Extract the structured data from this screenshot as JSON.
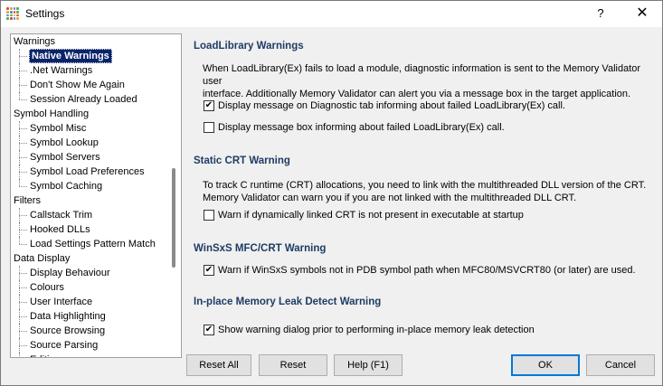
{
  "window": {
    "title": "Settings",
    "help_label": "?",
    "close_label": "✕"
  },
  "tree": {
    "items": [
      {
        "label": "Warnings",
        "level": 0
      },
      {
        "label": "Native Warnings",
        "level": 1,
        "selected": true
      },
      {
        "label": ".Net Warnings",
        "level": 1
      },
      {
        "label": "Don't Show Me Again",
        "level": 1
      },
      {
        "label": "Session Already Loaded",
        "level": 1,
        "last": true
      },
      {
        "label": "Symbol Handling",
        "level": 0
      },
      {
        "label": "Symbol Misc",
        "level": 1
      },
      {
        "label": "Symbol Lookup",
        "level": 1
      },
      {
        "label": "Symbol Servers",
        "level": 1
      },
      {
        "label": "Symbol Load Preferences",
        "level": 1
      },
      {
        "label": "Symbol Caching",
        "level": 1,
        "last": true
      },
      {
        "label": "Filters",
        "level": 0
      },
      {
        "label": "Callstack Trim",
        "level": 1
      },
      {
        "label": "Hooked DLLs",
        "level": 1
      },
      {
        "label": "Load Settings Pattern Match",
        "level": 1,
        "last": true
      },
      {
        "label": "Data Display",
        "level": 0
      },
      {
        "label": "Display Behaviour",
        "level": 1
      },
      {
        "label": "Colours",
        "level": 1
      },
      {
        "label": "User Interface",
        "level": 1
      },
      {
        "label": "Data Highlighting",
        "level": 1
      },
      {
        "label": "Source Browsing",
        "level": 1
      },
      {
        "label": "Source Parsing",
        "level": 1
      },
      {
        "label": "Editing",
        "level": 1
      }
    ]
  },
  "sections": {
    "loadlibrary": {
      "title": "LoadLibrary Warnings",
      "description_line1": "When LoadLibrary(Ex) fails to load a module, diagnostic information is sent to the Memory Validator user",
      "description_line2": "interface. Additionally Memory Validator can alert you via a message box in the target application.",
      "check1_label": "Display message on Diagnostic tab informing about failed LoadLibrary(Ex) call.",
      "check1_checked": true,
      "check2_label": "Display message box informing about failed LoadLibrary(Ex) call.",
      "check2_checked": false
    },
    "static_crt": {
      "title": "Static CRT Warning",
      "description_line1": "To track C runtime (CRT) allocations, you need to link with the multithreaded DLL version of the CRT.",
      "description_line2": "Memory Validator can warn you if you are not linked with the multithreaded DLL CRT.",
      "check_label": "Warn if dynamically linked CRT is not present in executable at startup",
      "check_checked": false
    },
    "winsxs": {
      "title": "WinSxS MFC/CRT Warning",
      "check_label": "Warn if WinSxS symbols not in PDB symbol path when MFC80/MSVCRT80 (or later) are used.",
      "check_checked": true
    },
    "inplace": {
      "title": "In-place Memory Leak Detect Warning",
      "check_label": "Show warning dialog prior to performing in-place memory leak detection",
      "check_checked": true
    }
  },
  "buttons": {
    "reset_all": "Reset All",
    "reset": "Reset",
    "help": "Help (F1)",
    "ok": "OK",
    "cancel": "Cancel"
  },
  "colors": {
    "section_title": "#1e3c64",
    "selection": "#0a246a",
    "default_button_border": "#0078d7"
  }
}
